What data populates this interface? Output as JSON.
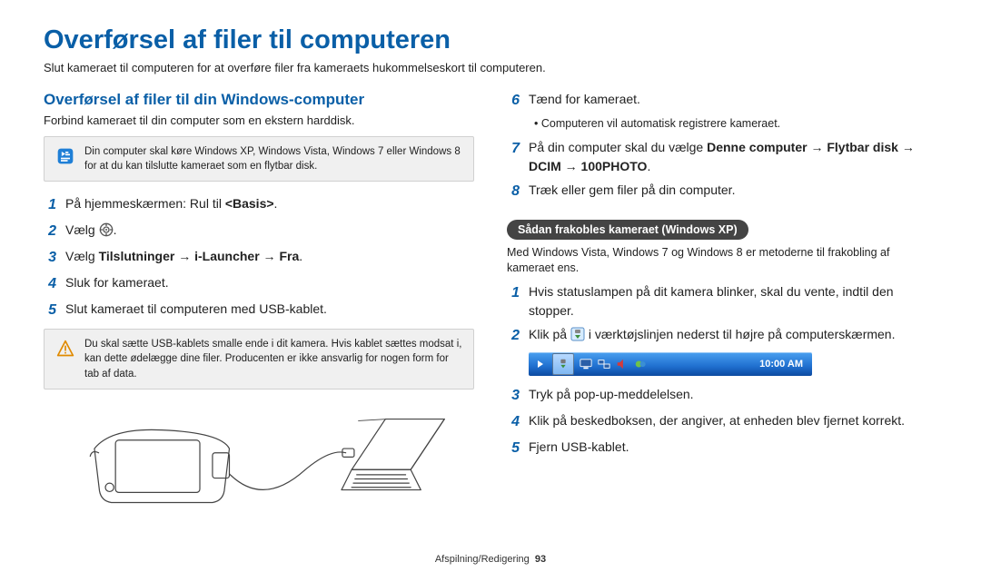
{
  "title": "Overførsel af filer til computeren",
  "subtitle": "Slut kameraet til computeren for at overføre filer fra kameraets hukommelseskort til computeren.",
  "left": {
    "section_head": "Overførsel af filer til din Windows-computer",
    "intro": "Forbind kameraet til din computer som en ekstern harddisk.",
    "info_note": "Din computer skal køre Windows XP, Windows Vista, Windows 7 eller Windows 8 for at du kan tilslutte kameraet som en flytbar disk.",
    "steps": [
      {
        "n": "1",
        "pre": "På hjemmeskærmen: Rul til ",
        "bold": "<Basis>",
        "post": "."
      },
      {
        "n": "2",
        "text": "Vælg "
      },
      {
        "n": "3",
        "pre": "Vælg ",
        "bold": "Tilslutninger → i-Launcher → Fra",
        "post": "."
      },
      {
        "n": "4",
        "text": "Sluk for kameraet."
      },
      {
        "n": "5",
        "text": "Slut kameraet til computeren med USB-kablet."
      }
    ],
    "warn_note": "Du skal sætte USB-kablets smalle ende i dit kamera. Hvis kablet sættes modsat i, kan dette ødelægge dine filer. Producenten er ikke ansvarlig for nogen form for tab af data."
  },
  "right": {
    "steps_a": [
      {
        "n": "6",
        "text": "Tænd for kameraet."
      }
    ],
    "sub_a": "Computeren vil automatisk registrere kameraet.",
    "steps_b": [
      {
        "n": "7",
        "pre": "På din computer skal du vælge ",
        "bold": "Denne computer → Flytbar disk → DCIM → 100PHOTO",
        "post": "."
      },
      {
        "n": "8",
        "text": "Træk eller gem filer på din computer."
      }
    ],
    "pill": "Sådan frakobles kameraet (Windows XP)",
    "pill_sub": "Med Windows Vista, Windows 7 og Windows 8 er metoderne til frakobling af kameraet ens.",
    "steps_c": [
      {
        "n": "1",
        "text": "Hvis statuslampen på dit kamera blinker, skal du vente, indtil den stopper."
      },
      {
        "n": "2",
        "pre": "Klik på ",
        "post": " i værktøjslinjen nederst til højre på computerskærmen."
      }
    ],
    "taskbar_time": "10:00 AM",
    "steps_d": [
      {
        "n": "3",
        "text": "Tryk på pop-up-meddelelsen."
      },
      {
        "n": "4",
        "text": "Klik på beskedboksen, der angiver, at enheden blev fjernet korrekt."
      },
      {
        "n": "5",
        "text": "Fjern USB-kablet."
      }
    ]
  },
  "footer": {
    "section": "Afspilning/Redigering",
    "page": "93"
  }
}
